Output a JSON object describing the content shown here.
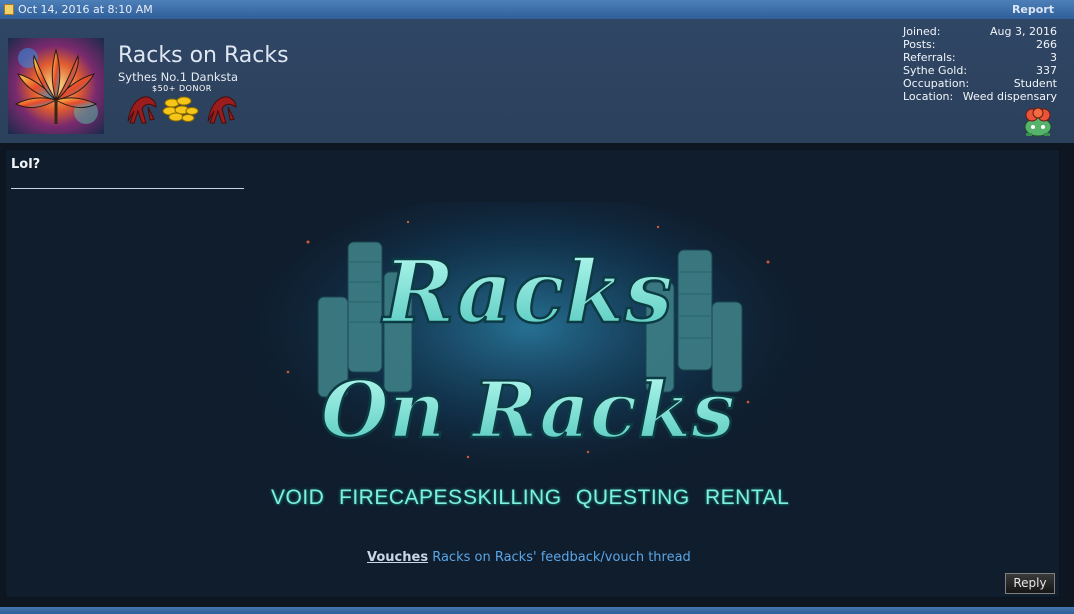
{
  "topbar": {
    "date": "Oct 14, 2016 at 8:10 AM",
    "report_label": "Report"
  },
  "user": {
    "name": "Racks on Racks",
    "title": "Sythes No.1 Danksta",
    "donor_label": "$50+ DONOR",
    "stats": [
      {
        "label": "Joined:",
        "value": "Aug 3, 2016"
      },
      {
        "label": "Posts:",
        "value": "266"
      },
      {
        "label": "Referrals:",
        "value": "3"
      },
      {
        "label": "Sythe Gold:",
        "value": "337"
      },
      {
        "label": "Occupation:",
        "value": "Student"
      },
      {
        "label": "Location:",
        "value": "Weed dispensary"
      }
    ]
  },
  "post": {
    "message": "Lol?",
    "banner": {
      "line1": "Racks",
      "line2": "On Racks",
      "services": [
        "VOID",
        "FIRECAPES",
        "SKILLING",
        "QUESTING",
        "RENTAL"
      ]
    },
    "vouch_label": "Vouches",
    "vouch_link": "Racks on Racks' feedback/vouch thread",
    "reply_label": "Reply"
  },
  "colors": {
    "accent": "#2f5f99",
    "content_bg": "#0f1d2d",
    "teal": "#7ff0df",
    "link": "#5aa6e6"
  }
}
